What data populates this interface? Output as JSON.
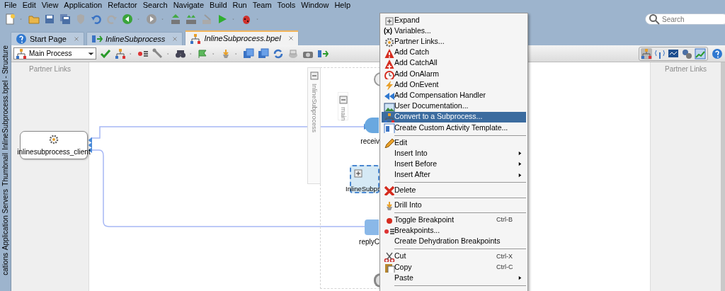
{
  "menubar": [
    "File",
    "Edit",
    "View",
    "Application",
    "Refactor",
    "Search",
    "Navigate",
    "Build",
    "Run",
    "Team",
    "Tools",
    "Window",
    "Help"
  ],
  "search": {
    "placeholder": "Search"
  },
  "tabs": [
    {
      "label": "Start Page",
      "kind": "page",
      "selected": false
    },
    {
      "label": "InlineSubprocess",
      "kind": "diagram",
      "selected": false
    },
    {
      "label": "InlineSubprocess.bpel",
      "kind": "bpel",
      "selected": true
    }
  ],
  "side_tabs": [
    "InlineSubprocess.bpel - Structure",
    "Thumbnail",
    "Application Servers",
    "cations"
  ],
  "process_selector": {
    "value": "Main Process"
  },
  "left_panel": {
    "title": "Partner Links"
  },
  "right_panel": {
    "title": "Partner Links"
  },
  "diagram": {
    "partner_link": "inlinesubprocess_client",
    "scope_label": "InlineSubprocess",
    "sequence_label": "main",
    "activities": [
      {
        "label": "receiv",
        "kind": "receive",
        "selected": false
      },
      {
        "label": "InlineSubpr",
        "kind": "subprocess",
        "selected": true
      },
      {
        "label": "replyC",
        "kind": "reply",
        "selected": false
      }
    ]
  },
  "context_menu": {
    "items": [
      {
        "kind": "item",
        "label": "Expand",
        "selected": false
      },
      {
        "kind": "item",
        "label": "Variables...",
        "glyph": "(x)",
        "selected": false
      },
      {
        "kind": "item",
        "label": "Partner Links...",
        "selected": false
      },
      {
        "kind": "item",
        "label": "Add Catch",
        "selected": false
      },
      {
        "kind": "item",
        "label": "Add CatchAll",
        "selected": false
      },
      {
        "kind": "item",
        "label": "Add OnAlarm",
        "selected": false
      },
      {
        "kind": "item",
        "label": "Add OnEvent",
        "selected": false
      },
      {
        "kind": "item",
        "label": "Add Compensation Handler",
        "selected": false
      },
      {
        "kind": "item",
        "label": "User Documentation...",
        "selected": false
      },
      {
        "kind": "item",
        "label": "Convert to a Subprocess...",
        "selected": true
      },
      {
        "kind": "item",
        "label": "Create Custom Activity Template...",
        "selected": false
      },
      {
        "kind": "separator"
      },
      {
        "kind": "item",
        "label": "Edit",
        "selected": false
      },
      {
        "kind": "item",
        "label": "Insert Into",
        "submenu": true,
        "selected": false
      },
      {
        "kind": "item",
        "label": "Insert Before",
        "submenu": true,
        "selected": false
      },
      {
        "kind": "item",
        "label": "Insert After",
        "submenu": true,
        "selected": false
      },
      {
        "kind": "separator"
      },
      {
        "kind": "item",
        "label": "Delete",
        "selected": false
      },
      {
        "kind": "separator"
      },
      {
        "kind": "item",
        "label": "Drill Into",
        "selected": false
      },
      {
        "kind": "separator"
      },
      {
        "kind": "item",
        "label": "Toggle Breakpoint",
        "shortcut": "Ctrl-B",
        "selected": false
      },
      {
        "kind": "item",
        "label": "Breakpoints...",
        "selected": false
      },
      {
        "kind": "item",
        "label": "Create Dehydration Breakpoints",
        "selected": false
      },
      {
        "kind": "separator"
      },
      {
        "kind": "item",
        "label": "Cut",
        "shortcut": "Ctrl-X",
        "selected": false
      },
      {
        "kind": "item",
        "label": "Copy",
        "shortcut": "Ctrl-C",
        "selected": false
      },
      {
        "kind": "item",
        "label": "Paste",
        "submenu": true,
        "selected": false
      },
      {
        "kind": "separator"
      }
    ]
  }
}
